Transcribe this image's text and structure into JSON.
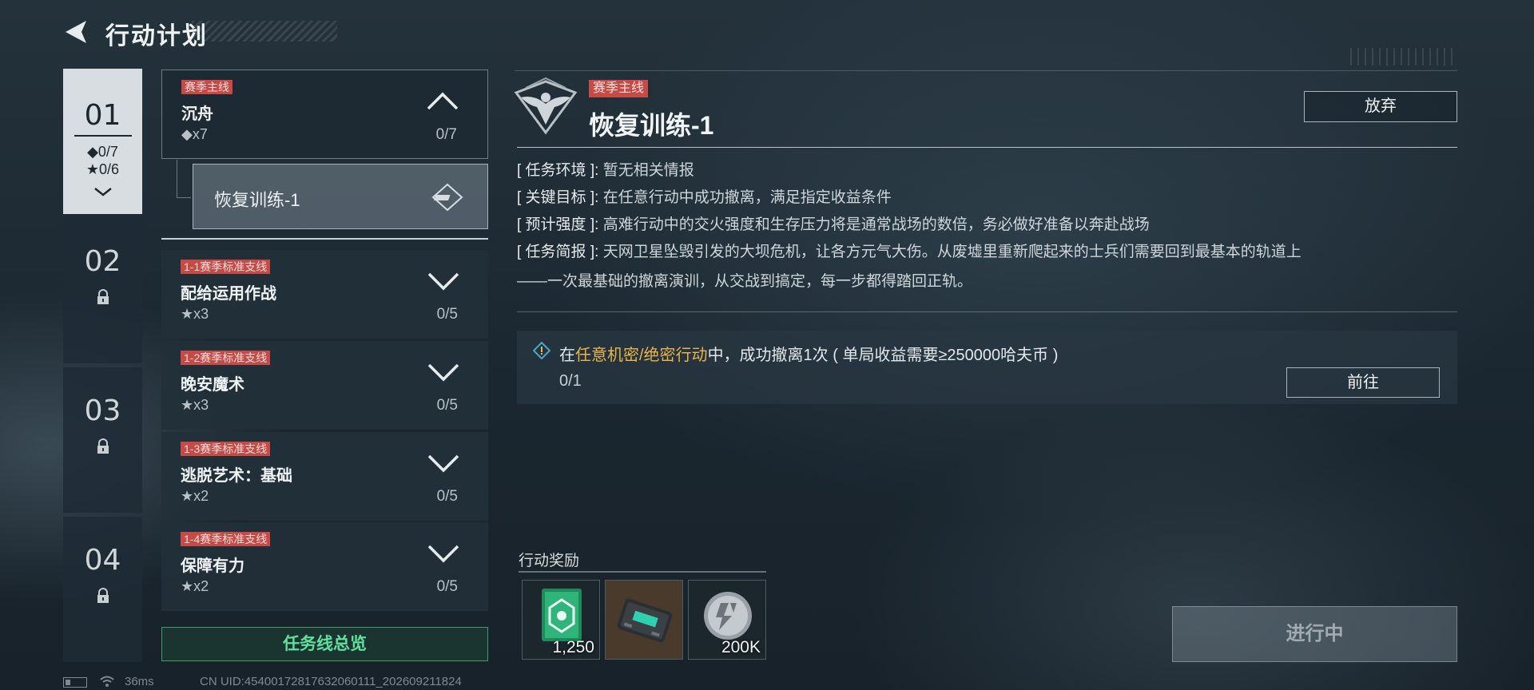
{
  "header": {
    "title": "行动计划"
  },
  "chapters": [
    {
      "number": "01",
      "diamond_progress": "◆0/7",
      "star_progress": "★0/6"
    },
    {
      "number": "02"
    },
    {
      "number": "03"
    },
    {
      "number": "04"
    }
  ],
  "main_task": {
    "tag": "赛季主线",
    "name": "沉舟",
    "requirement": "◆x7",
    "count": "0/7"
  },
  "sub_task": {
    "label": "恢复训练-1"
  },
  "tasks": [
    {
      "tag": "1-1赛季标准支线",
      "name": "配给运用作战",
      "requirement": "★x3",
      "count": "0/5"
    },
    {
      "tag": "1-2赛季标准支线",
      "name": "晚安魔术",
      "requirement": "★x3",
      "count": "0/5"
    },
    {
      "tag": "1-3赛季标准支线",
      "name": "逃脱艺术：基础",
      "requirement": "★x2",
      "count": "0/5"
    },
    {
      "tag": "1-4赛季标准支线",
      "name": "保障有力",
      "requirement": "★x2",
      "count": "0/5"
    }
  ],
  "overview_button": "任务线总览",
  "detail": {
    "tag": "赛季主线",
    "title": "恢复训练-1",
    "abandon_label": "放弃",
    "info": [
      {
        "key": "[ 任务环境 ]:",
        "value": "暂无相关情报"
      },
      {
        "key": "[ 关键目标 ]:",
        "value": "在任意行动中成功撤离，满足指定收益条件"
      },
      {
        "key": "[ 预计强度 ]:",
        "value": "高难行动中的交火强度和生存压力将是通常战场的数倍，务必做好准备以奔赴战场"
      },
      {
        "key": "[ 任务简报 ]:",
        "value": "天网卫星坠毁引发的大坝危机，让各方元气大伤。从废墟里重新爬起来的士兵们需要回到最基本的轨道上"
      }
    ],
    "briefing_cont": "——一次最基础的撤离演训，从交战到搞定，每一步都得踏回正轨。",
    "objective": {
      "prefix": "在",
      "highlight": "任意机密/绝密行动",
      "suffix": "中，成功撤离1次 ( 单局收益需要≥250000哈夫币 )",
      "progress": "0/1",
      "goto_label": "前往"
    },
    "rewards_label": "行动奖励",
    "rewards": [
      {
        "icon": "green-card-icon",
        "amount": "1,250"
      },
      {
        "icon": "equipment-case-icon",
        "amount": ""
      },
      {
        "icon": "silver-coin-icon",
        "amount": "200K"
      }
    ],
    "status_button": "进行中"
  },
  "status_bar": {
    "ping": "36ms",
    "uid": "CN UID:45400172817632060111_202609211824"
  },
  "colors": {
    "tag_red": "#c64a45",
    "highlight_gold": "#e9b54a",
    "overview_green": "#5fe0a0"
  }
}
